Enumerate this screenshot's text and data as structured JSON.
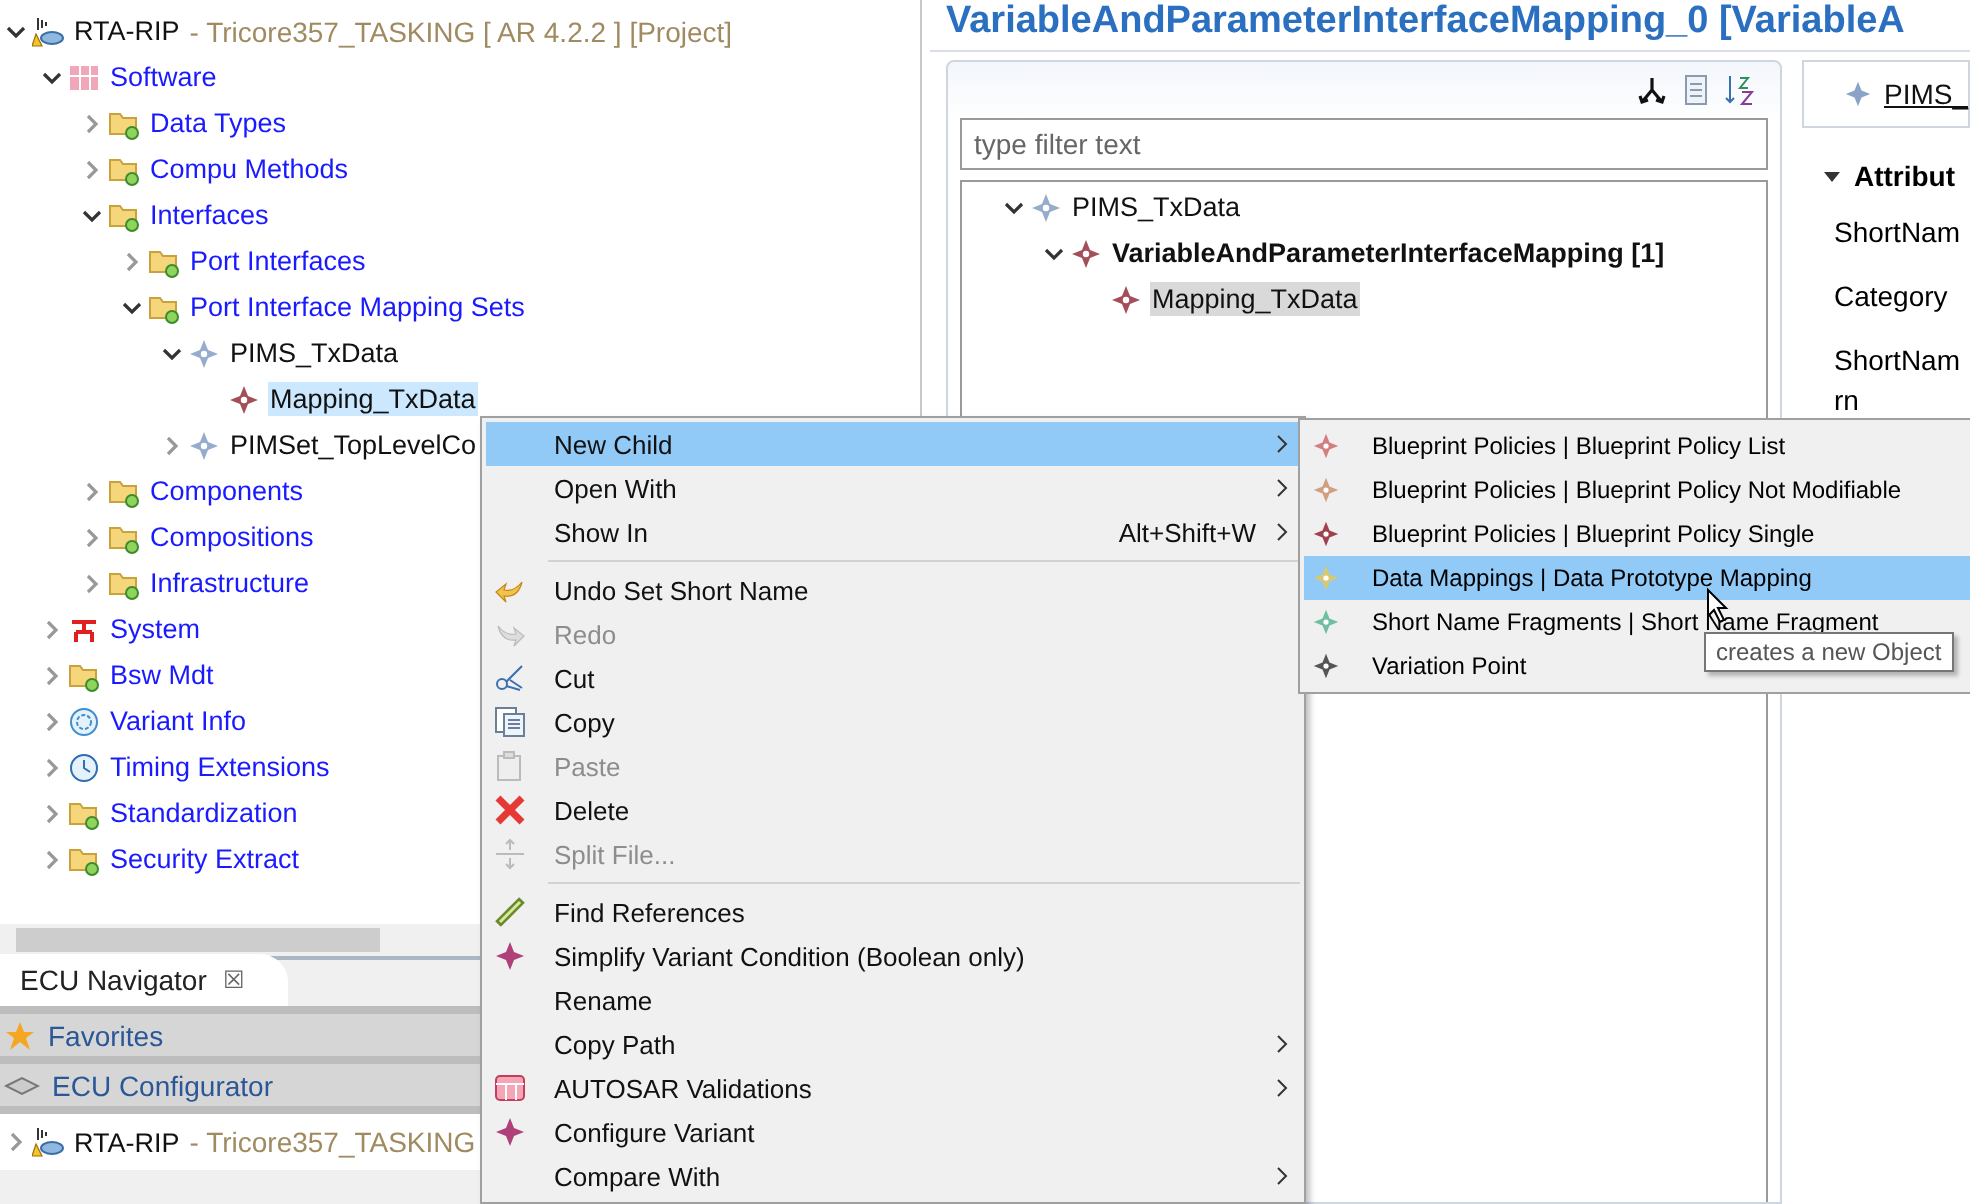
{
  "project_tree": [
    {
      "label": "RTA-RIP",
      "suffix": "- Tricore357_TASKING [ AR 4.2.2 ] [Project]",
      "kind": "project",
      "expanded": true,
      "selected": false,
      "children": [
        {
          "label": "Software",
          "kind": "software",
          "expanded": true,
          "selected": false,
          "children": [
            {
              "label": "Data Types",
              "kind": "folder",
              "expanded": false,
              "selected": false
            },
            {
              "label": "Compu Methods",
              "kind": "folder",
              "expanded": false,
              "selected": false
            },
            {
              "label": "Interfaces",
              "kind": "folder",
              "expanded": true,
              "selected": false,
              "children": [
                {
                  "label": "Port Interfaces",
                  "kind": "folder",
                  "expanded": false,
                  "selected": false
                },
                {
                  "label": "Port Interface Mapping Sets",
                  "kind": "folder",
                  "expanded": true,
                  "selected": false,
                  "children": [
                    {
                      "label": "PIMS_TxData",
                      "kind": "element",
                      "expanded": true,
                      "selected": false,
                      "children": [
                        {
                          "label": "Mapping_TxData",
                          "kind": "mapping",
                          "selected": true
                        }
                      ]
                    },
                    {
                      "label": "PIMSet_TopLevelCo",
                      "kind": "element",
                      "expanded": false,
                      "selected": false
                    }
                  ]
                }
              ]
            },
            {
              "label": "Components",
              "kind": "folder",
              "expanded": false,
              "selected": false
            },
            {
              "label": "Compositions",
              "kind": "folder",
              "expanded": false,
              "selected": false
            },
            {
              "label": "Infrastructure",
              "kind": "folder",
              "expanded": false,
              "selected": false
            }
          ]
        },
        {
          "label": "System",
          "kind": "system",
          "expanded": false,
          "selected": false
        },
        {
          "label": "Bsw Mdt",
          "kind": "folder",
          "expanded": false,
          "selected": false
        },
        {
          "label": "Variant Info",
          "kind": "variant",
          "expanded": false,
          "selected": false
        },
        {
          "label": "Timing Extensions",
          "kind": "timing",
          "expanded": false,
          "selected": false
        },
        {
          "label": "Standardization",
          "kind": "folder",
          "expanded": false,
          "selected": false
        },
        {
          "label": "Security Extract",
          "kind": "folder",
          "expanded": false,
          "selected": false
        }
      ]
    }
  ],
  "navigator": {
    "tab": "ECU Navigator",
    "close": "☒",
    "sections": [
      {
        "label": "Favorites",
        "kind": "star"
      },
      {
        "label": "ECU Configurator",
        "kind": "configurator"
      }
    ],
    "project": {
      "label": "RTA-RIP",
      "suffix": "- Tricore357_TASKING",
      "expanded": false
    }
  },
  "editor": {
    "title": "VariableAndParameterInterfaceMapping_0 [VariableA",
    "filter": {
      "placeholder": "type filter text"
    },
    "tree": [
      {
        "label": "PIMS_TxData",
        "kind": "element",
        "bold": false,
        "expanded": true,
        "selected": false,
        "children": [
          {
            "label": "VariableAndParameterInterfaceMapping [1]",
            "kind": "mapping",
            "bold": true,
            "expanded": true,
            "selected": false,
            "children": [
              {
                "label": "Mapping_TxData",
                "kind": "mapping",
                "bold": false,
                "selected": true
              }
            ]
          }
        ]
      }
    ],
    "details": {
      "link": "PIMS_",
      "section": "Attribut",
      "fields": [
        "ShortNam",
        "Category",
        "ShortNam\nrn"
      ]
    }
  },
  "context_menu": [
    {
      "kind": "item",
      "label": "New Child",
      "submenu": true,
      "disabled": false,
      "selected": true
    },
    {
      "kind": "item",
      "label": "Open With",
      "submenu": true,
      "disabled": false,
      "selected": false
    },
    {
      "kind": "item",
      "label": "Show In",
      "shortcut": "Alt+Shift+W",
      "submenu": true,
      "disabled": false,
      "selected": false
    },
    {
      "kind": "separator"
    },
    {
      "kind": "item",
      "label": "Undo Set Short Name",
      "submenu": false,
      "disabled": false,
      "selected": false
    },
    {
      "kind": "item",
      "label": "Redo",
      "submenu": false,
      "disabled": true,
      "selected": false
    },
    {
      "kind": "item",
      "label": "Cut",
      "submenu": false,
      "disabled": false,
      "selected": false
    },
    {
      "kind": "item",
      "label": "Copy",
      "submenu": false,
      "disabled": false,
      "selected": false
    },
    {
      "kind": "item",
      "label": "Paste",
      "submenu": false,
      "disabled": true,
      "selected": false
    },
    {
      "kind": "item",
      "label": "Delete",
      "submenu": false,
      "disabled": false,
      "selected": false
    },
    {
      "kind": "item",
      "label": "Split File...",
      "submenu": false,
      "disabled": true,
      "selected": false
    },
    {
      "kind": "separator"
    },
    {
      "kind": "item",
      "label": "Find References",
      "submenu": false,
      "disabled": false,
      "selected": false
    },
    {
      "kind": "item",
      "label": "Simplify Variant Condition (Boolean only)",
      "submenu": false,
      "disabled": false,
      "selected": false
    },
    {
      "kind": "item",
      "label": "Rename",
      "submenu": false,
      "disabled": false,
      "selected": false
    },
    {
      "kind": "item",
      "label": "Copy Path",
      "submenu": true,
      "disabled": false,
      "selected": false
    },
    {
      "kind": "item",
      "label": "AUTOSAR Validations",
      "submenu": true,
      "disabled": false,
      "selected": false
    },
    {
      "kind": "item",
      "label": "Configure Variant",
      "submenu": false,
      "disabled": false,
      "selected": false
    },
    {
      "kind": "item",
      "label": "Compare With",
      "submenu": true,
      "disabled": false,
      "selected": false
    }
  ],
  "submenu": [
    {
      "label": "Blueprint Policies | Blueprint Policy List",
      "selected": false
    },
    {
      "label": "Blueprint Policies | Blueprint Policy Not Modifiable",
      "selected": false
    },
    {
      "label": "Blueprint Policies | Blueprint Policy Single",
      "selected": false
    },
    {
      "label": "Data Mappings | Data Prototype Mapping",
      "selected": true
    },
    {
      "label": "Short Name Fragments | Short Name Fragment",
      "selected": false
    },
    {
      "label": "Variation Point",
      "selected": false
    }
  ],
  "tooltip": "creates a new Object"
}
